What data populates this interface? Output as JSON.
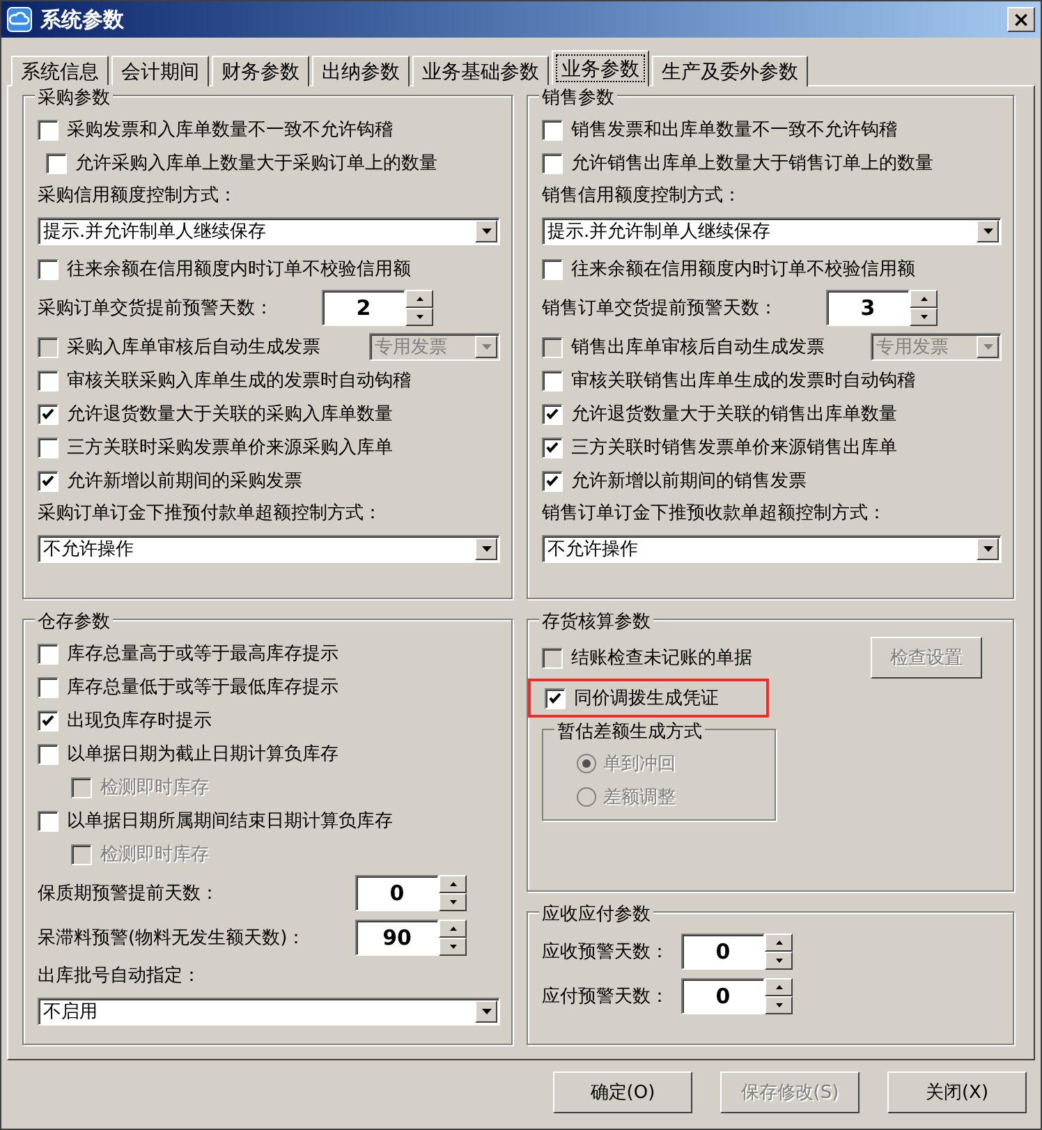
{
  "window": {
    "title": "系统参数",
    "close": "×"
  },
  "tabs": [
    {
      "label": "系统信息",
      "selected": false
    },
    {
      "label": "会计期间",
      "selected": false
    },
    {
      "label": "财务参数",
      "selected": false
    },
    {
      "label": "出纳参数",
      "selected": false
    },
    {
      "label": "业务基础参数",
      "selected": false
    },
    {
      "label": "业务参数",
      "selected": true
    },
    {
      "label": "生产及委外参数",
      "selected": false
    }
  ],
  "purchase": {
    "title": "采购参数",
    "items": [
      {
        "kind": "checkbox",
        "label": "采购发票和入库单数量不一致不允许钩稽",
        "checked": false
      },
      {
        "kind": "checkbox",
        "label": "允许采购入库单上数量大于采购订单上的数量",
        "checked": false,
        "indent": true
      },
      {
        "kind": "label",
        "label": "采购信用额度控制方式："
      },
      {
        "kind": "select",
        "value": "提示.并允许制单人继续保存"
      },
      {
        "kind": "checkbox",
        "label": "往来余额在信用额度内时订单不校验信用额",
        "checked": false
      },
      {
        "kind": "spinner",
        "label": "采购订单交货提前预警天数：",
        "value": "2"
      },
      {
        "kind": "checkbox_select",
        "label": "采购入库单审核后自动生成发票",
        "checked": false,
        "select": "专用发票",
        "disabled": true
      },
      {
        "kind": "checkbox",
        "label": "审核关联采购入库单生成的发票时自动钩稽",
        "checked": false
      },
      {
        "kind": "checkbox",
        "label": "允许退货数量大于关联的采购入库单数量",
        "checked": true
      },
      {
        "kind": "checkbox",
        "label": "三方关联时采购发票单价来源采购入库单",
        "checked": false
      },
      {
        "kind": "checkbox",
        "label": "允许新增以前期间的采购发票",
        "checked": true
      },
      {
        "kind": "label",
        "label": "采购订单订金下推预付款单超额控制方式："
      },
      {
        "kind": "select",
        "value": "不允许操作"
      }
    ]
  },
  "sales": {
    "title": "销售参数",
    "items": [
      {
        "kind": "checkbox",
        "label": "销售发票和出库单数量不一致不允许钩稽",
        "checked": false
      },
      {
        "kind": "checkbox",
        "label": "允许销售出库单上数量大于销售订单上的数量",
        "checked": false
      },
      {
        "kind": "label",
        "label": "销售信用额度控制方式："
      },
      {
        "kind": "select",
        "value": "提示.并允许制单人继续保存"
      },
      {
        "kind": "checkbox",
        "label": "往来余额在信用额度内时订单不校验信用额",
        "checked": false
      },
      {
        "kind": "spinner",
        "label": "销售订单交货提前预警天数：",
        "value": "3"
      },
      {
        "kind": "checkbox_select",
        "label": "销售出库单审核后自动生成发票",
        "checked": false,
        "select": "专用发票",
        "disabled": true
      },
      {
        "kind": "checkbox",
        "label": "审核关联销售出库单生成的发票时自动钩稽",
        "checked": false
      },
      {
        "kind": "checkbox",
        "label": "允许退货数量大于关联的销售出库单数量",
        "checked": true
      },
      {
        "kind": "checkbox",
        "label": "三方关联时销售发票单价来源销售出库单",
        "checked": true
      },
      {
        "kind": "checkbox",
        "label": "允许新增以前期间的销售发票",
        "checked": true
      },
      {
        "kind": "label",
        "label": "销售订单订金下推预收款单超额控制方式："
      },
      {
        "kind": "select",
        "value": "不允许操作"
      }
    ]
  },
  "warehouse": {
    "title": "仓存参数",
    "items": [
      {
        "kind": "checkbox",
        "label": "库存总量高于或等于最高库存提示",
        "checked": false
      },
      {
        "kind": "checkbox",
        "label": "库存总量低于或等于最低库存提示",
        "checked": false
      },
      {
        "kind": "checkbox",
        "label": "出现负库存时提示",
        "checked": true
      },
      {
        "kind": "checkbox",
        "label": "以单据日期为截止日期计算负库存",
        "checked": false,
        "children": [
          {
            "kind": "checkbox",
            "label": "检测即时库存",
            "checked": false,
            "disabled": true
          }
        ]
      },
      {
        "kind": "checkbox",
        "label": "以单据日期所属期间结束日期计算负库存",
        "checked": false,
        "children": [
          {
            "kind": "checkbox",
            "label": "检测即时库存",
            "checked": false,
            "disabled": true
          }
        ]
      },
      {
        "kind": "spinner",
        "label": "保质期预警提前天数：",
        "value": "0"
      },
      {
        "kind": "spinner",
        "label": "呆滞料预警(物料无发生额天数)：",
        "value": "90"
      },
      {
        "kind": "label",
        "label": "出库批号自动指定："
      },
      {
        "kind": "select",
        "value": "不启用"
      }
    ]
  },
  "inventory_accounting": {
    "title": "存货核算参数",
    "items": [
      {
        "kind": "checkbox_button",
        "label": "结账检查未记账的单据",
        "checked": false,
        "button": "检查设置",
        "disabled": true
      },
      {
        "kind": "checkbox",
        "label": "同价调拨生成凭证",
        "checked": true,
        "highlighted": true
      },
      {
        "kind": "radio_group",
        "title": "暂估差额生成方式",
        "disabled": true,
        "options": [
          {
            "label": "单到冲回",
            "selected": true
          },
          {
            "label": "差额调整",
            "selected": false
          }
        ]
      }
    ]
  },
  "receivables_payables": {
    "title": "应收应付参数",
    "items": [
      {
        "kind": "spinner",
        "label": "应收预警天数：",
        "value": "0"
      },
      {
        "kind": "spinner",
        "label": "应付预警天数：",
        "value": "0"
      }
    ]
  },
  "buttons": [
    {
      "label": "确定(O)",
      "disabled": false
    },
    {
      "label": "保存修改(S)",
      "disabled": true
    },
    {
      "label": "关闭(X)",
      "disabled": false
    }
  ]
}
